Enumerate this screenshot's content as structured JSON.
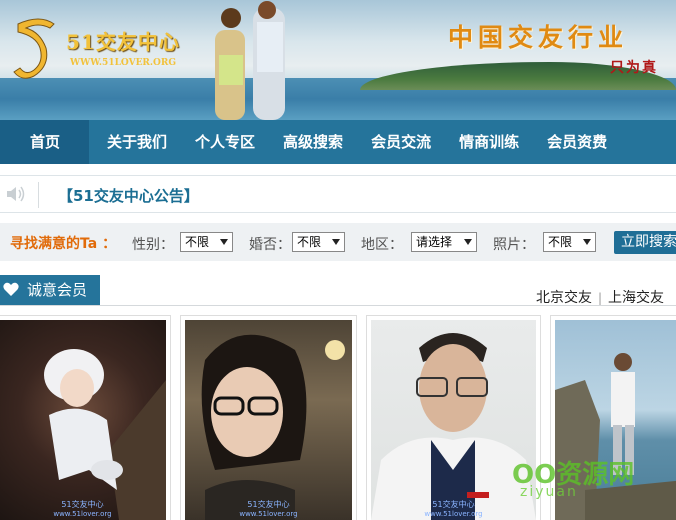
{
  "banner": {
    "logo_name": "51交友中心",
    "logo_url": "WWW.51LOVER.ORG",
    "slogan": "中国交友行业",
    "slogan_sub": "只为真"
  },
  "nav": {
    "items": [
      {
        "label": "首页"
      },
      {
        "label": "关于我们"
      },
      {
        "label": "个人专区"
      },
      {
        "label": "高级搜索"
      },
      {
        "label": "会员交流"
      },
      {
        "label": "情商训练"
      },
      {
        "label": "会员资费"
      }
    ]
  },
  "notice": {
    "text": "【51交友中心公告】"
  },
  "search": {
    "lead": "寻找满意的Ta ：",
    "gender_label": "性别：",
    "gender_value": "不限",
    "marital_label": "婚否：",
    "marital_value": "不限",
    "region_label": "地区：",
    "region_value": "请选择",
    "photo_label": "照片：",
    "photo_value": "不限",
    "submit": "立即搜索"
  },
  "members": {
    "title": "诚意会员",
    "city_links": [
      "北京交友",
      "上海交友"
    ],
    "photo_watermark": "51交友中心",
    "photo_watermark_url": "www.51lover.org"
  },
  "site_watermark": {
    "main": "OO资源网",
    "sub": "ziyuan"
  },
  "colors": {
    "nav_bg": "#25749b",
    "nav_active": "#1a5f86",
    "accent_orange": "#e16b0a",
    "notice_blue": "#1b6e93"
  }
}
